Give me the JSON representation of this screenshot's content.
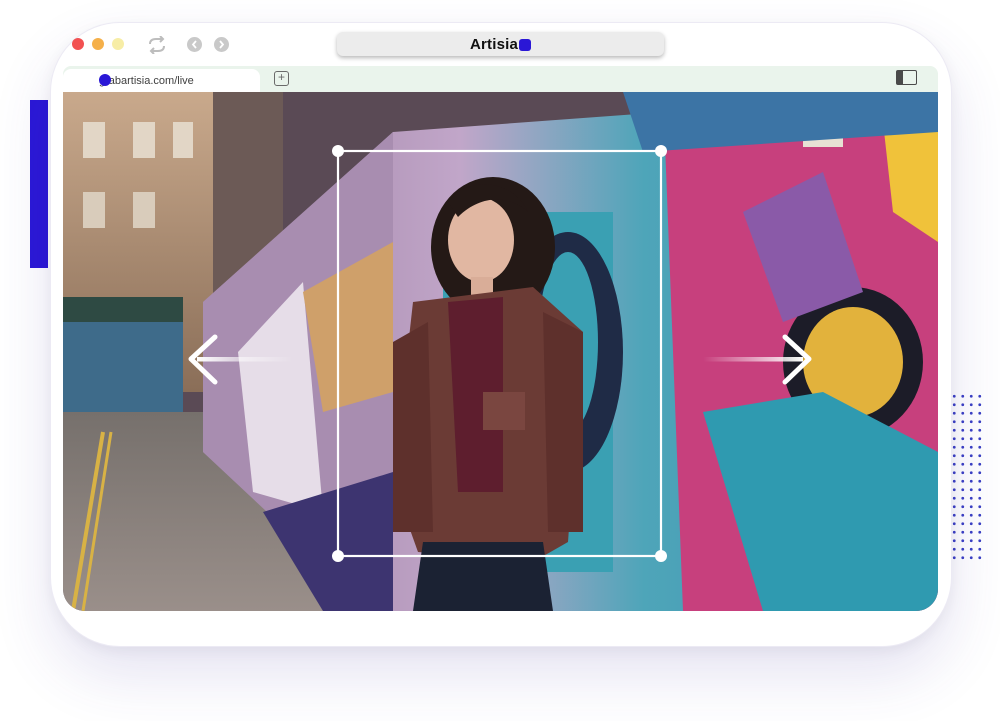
{
  "browser": {
    "title": "Artisia",
    "tab_url": "grabartisia.com/live"
  },
  "icons": {
    "window_controls": [
      "close-dot",
      "minimize-dot",
      "maximize-dot"
    ],
    "refresh": "refresh-icon",
    "back": "chevron-left-icon",
    "forward": "chevron-right-icon",
    "new_tab": "new-tab-icon",
    "sidebar": "sidebar-toggle-icon",
    "expand_left": "arrow-left-icon",
    "expand_right": "arrow-right-icon"
  },
  "colors": {
    "brand": "#2a17d6",
    "tabbar": "#eaf4ec",
    "crop_frame": "#ffffff"
  }
}
